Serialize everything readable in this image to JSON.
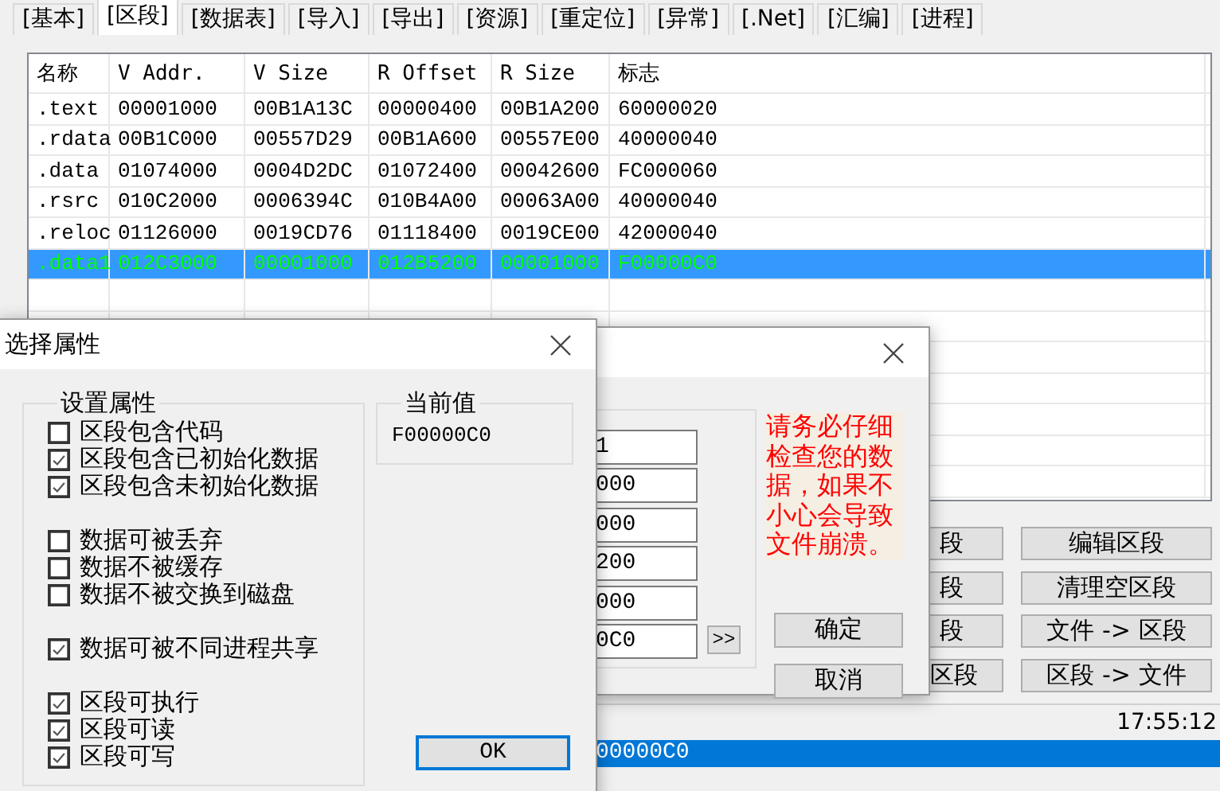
{
  "tabs": [
    {
      "label": "[基本]",
      "selected": false
    },
    {
      "label": "[区段]",
      "selected": true
    },
    {
      "label": "[数据表]",
      "selected": false
    },
    {
      "label": "[导入]",
      "selected": false
    },
    {
      "label": "[导出]",
      "selected": false
    },
    {
      "label": "[资源]",
      "selected": false
    },
    {
      "label": "[重定位]",
      "selected": false
    },
    {
      "label": "[异常]",
      "selected": false
    },
    {
      "label": "[.Net]",
      "selected": false
    },
    {
      "label": "[汇编]",
      "selected": false
    },
    {
      "label": "[进程]",
      "selected": false
    }
  ],
  "sections_table": {
    "columns": [
      "名称",
      "V Addr.",
      "V Size",
      "R Offset",
      "R Size",
      "标志"
    ],
    "rows": [
      {
        "cells": [
          ".text",
          "00001000",
          "00B1A13C",
          "00000400",
          "00B1A200",
          "60000020"
        ],
        "selected": false
      },
      {
        "cells": [
          ".rdata",
          "00B1C000",
          "00557D29",
          "00B1A600",
          "00557E00",
          "40000040"
        ],
        "selected": false
      },
      {
        "cells": [
          ".data",
          "01074000",
          "0004D2DC",
          "01072400",
          "00042600",
          "FC000060"
        ],
        "selected": false
      },
      {
        "cells": [
          ".rsrc",
          "010C2000",
          "0006394C",
          "010B4A00",
          "00063A00",
          "40000040"
        ],
        "selected": false
      },
      {
        "cells": [
          ".reloc",
          "01126000",
          "0019CD76",
          "01118400",
          "0019CE00",
          "42000040"
        ],
        "selected": false
      },
      {
        "cells": [
          ".data1",
          "012C3000",
          "00001000",
          "012B5200",
          "00001000",
          "F00000C0"
        ],
        "selected": true
      }
    ]
  },
  "left_buttons": [
    "段",
    "段",
    "段",
    "区段"
  ],
  "right_buttons": [
    "编辑区段",
    "清理空区段",
    "文件 -> 区段",
    "区段 -> 文件"
  ],
  "status_bar": {
    "time": "17:55:12",
    "value": "00000C0"
  },
  "edit_dialog": {
    "fields": [
      "1",
      "000",
      "000",
      "200",
      "000",
      "0C0"
    ],
    "expand_button": ">>",
    "warning": "请务必仔细检查您的数据，如果不小心会导致文件崩溃。",
    "buttons": [
      "确定",
      "取消"
    ]
  },
  "attributes_dialog": {
    "title": "选择属性",
    "group_title": "设置属性",
    "groups": [
      {
        "items": [
          {
            "label": "区段包含代码",
            "checked": false
          },
          {
            "label": "区段包含已初始化数据",
            "checked": true
          },
          {
            "label": "区段包含未初始化数据",
            "checked": true
          }
        ]
      },
      {
        "items": [
          {
            "label": "数据可被丢弃",
            "checked": false
          },
          {
            "label": "数据不被缓存",
            "checked": false
          },
          {
            "label": "数据不被交换到磁盘",
            "checked": false
          }
        ]
      },
      {
        "items": [
          {
            "label": "数据可被不同进程共享",
            "checked": true
          }
        ]
      },
      {
        "items": [
          {
            "label": "区段可执行",
            "checked": true
          },
          {
            "label": "区段可读",
            "checked": true
          },
          {
            "label": "区段可写",
            "checked": true
          }
        ]
      }
    ],
    "current_value_title": "当前值",
    "current_value": "F00000C0",
    "ok_button": "OK"
  }
}
